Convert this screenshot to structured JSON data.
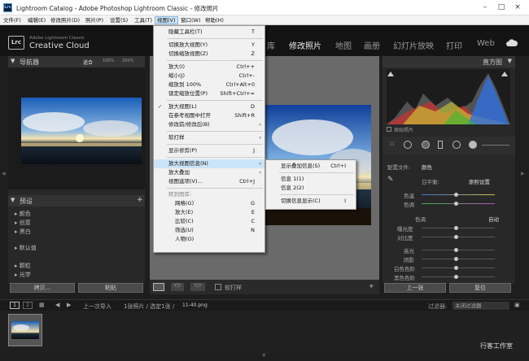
{
  "window": {
    "title": "Lightroom Catalog - Adobe Photoshop Lightroom Classic - 修改照片",
    "logo": "Lrc"
  },
  "menubar": [
    "文件(F)",
    "编辑(E)",
    "修改照片(D)",
    "照片(P)",
    "设置(S)",
    "工具(T)",
    "视图(V)",
    "窗口(W)",
    "帮助(H)"
  ],
  "brand": {
    "line1": "Adobe Lightroom Classic",
    "line2": "Creative Cloud"
  },
  "modules": [
    "库",
    "修改照片",
    "地图",
    "画册",
    "幻灯片放映",
    "打印",
    "Web"
  ],
  "navigator": {
    "title": "导航器",
    "zoom": [
      "适合",
      "100%",
      "200%"
    ]
  },
  "presets": {
    "title": "预设",
    "items": [
      "颜色",
      "创意",
      "黑白",
      "默认值",
      "颗粒",
      "光学"
    ]
  },
  "left_buttons": [
    "拷贝...",
    "粘贴"
  ],
  "right": {
    "histogram": "直方图",
    "original": "原始照片",
    "profile_label": "配置文件:",
    "profile_value": "颜色",
    "wb_label": "白平衡:",
    "wb_value": "原照设置",
    "rows": [
      "色温",
      "色调",
      "色调",
      "自动",
      "曝光度",
      "对比度",
      "高光",
      "阴影",
      "白色色阶",
      "黑色色阶"
    ],
    "buttons": [
      "上一张",
      "复位"
    ]
  },
  "toolbar": {
    "soft_proof": "软打样"
  },
  "filmstrip": {
    "pages": [
      "1",
      "2"
    ],
    "path": "上一次导入",
    "count": "1张照片 / 选定1张 /",
    "file": "11-40.png",
    "filter_label": "过滤器:",
    "filter_value": "关闭过滤器"
  },
  "watermark": "行客工作室",
  "view_menu": [
    {
      "label": "隐藏工具栏(T)",
      "sc": "T"
    },
    {
      "sep": true
    },
    {
      "label": "切换放大视图(Y)",
      "sc": "Y"
    },
    {
      "label": "切换缩放视图(Z)",
      "sc": "Z"
    },
    {
      "sep": true
    },
    {
      "label": "放大(I)",
      "sc": "Ctrl++"
    },
    {
      "label": "缩小(J)",
      "sc": "Ctrl+-"
    },
    {
      "label": "缩放到 100%",
      "sc": "Ctrl+Alt+0"
    },
    {
      "label": "锁定缩放位置(P)",
      "sc": "Shift+Ctrl+="
    },
    {
      "sep": true
    },
    {
      "label": "放大视图(L)",
      "sc": "D",
      "check": true
    },
    {
      "label": "在参考视图中打开",
      "sc": "Shift+R"
    },
    {
      "label": "修改前/修改后(B)",
      "arrow": true
    },
    {
      "sep": true
    },
    {
      "label": "软打样",
      "arrow": true
    },
    {
      "sep": true
    },
    {
      "label": "显示修剪(P)",
      "sc": "J"
    },
    {
      "sep": true
    },
    {
      "label": "放大视图信息(N)",
      "arrow": true,
      "hl": true
    },
    {
      "label": "放大叠加",
      "arrow": true
    },
    {
      "label": "视图选项(V)...",
      "sc": "Ctrl+J"
    },
    {
      "sep": true
    },
    {
      "label": "转到图库:",
      "disabled": true
    },
    {
      "label": "网格(G)",
      "sc": "G",
      "indent": true
    },
    {
      "label": "放大(E)",
      "sc": "E",
      "indent": true
    },
    {
      "label": "比较(C)",
      "sc": "C",
      "indent": true
    },
    {
      "label": "筛选(U)",
      "sc": "N",
      "indent": true
    },
    {
      "label": "人物(O)",
      "indent": true
    }
  ],
  "sub_menu": [
    {
      "label": "显示叠加信息(S)",
      "sc": "Ctrl+I"
    },
    {
      "sep": true
    },
    {
      "label": "信息 1(1)"
    },
    {
      "label": "信息 2(2)"
    },
    {
      "sep": true
    },
    {
      "label": "切换信息显示(C)",
      "sc": "I"
    }
  ]
}
